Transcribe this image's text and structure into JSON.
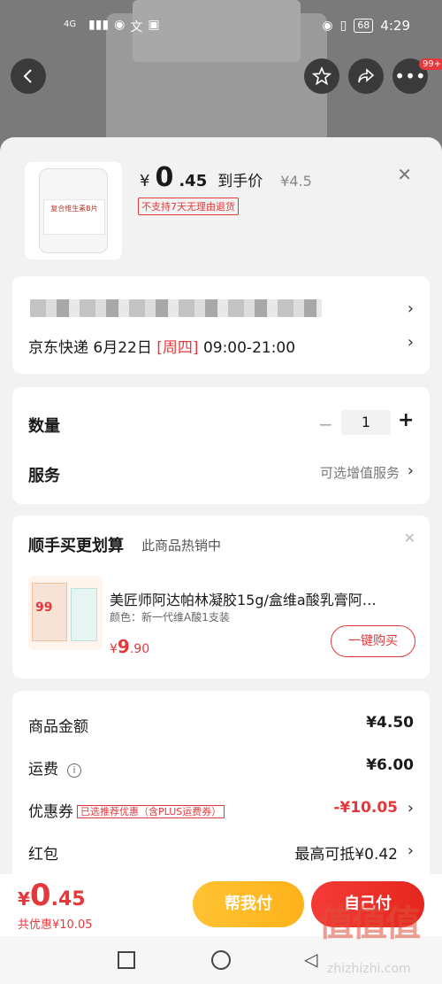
{
  "status_bar": {
    "network": "4G",
    "time": "4:29",
    "battery": "68"
  },
  "nav": {
    "more_badge": "99+"
  },
  "product": {
    "currency": "¥",
    "price_int": "0",
    "price_dec": ".45",
    "price_suffix": "到手价",
    "original_price": "¥4.5",
    "no_return_tag": "不支持7天无理由退货",
    "image_label": "复合维生素B片"
  },
  "address": {
    "delivery_carrier": "京东快递",
    "delivery_date": "6月22日",
    "delivery_day": "[周四]",
    "delivery_window": "09:00-21:00"
  },
  "quantity": {
    "label": "数量",
    "value": "1",
    "minus": "−",
    "plus": "+"
  },
  "service": {
    "label": "服务",
    "hint": "可选增值服务"
  },
  "recommend": {
    "title": "顺手买更划算",
    "subtitle": "此商品热销中",
    "item_name": "美匠师阿达帕林凝胶15g/盒维a酸乳膏阿…",
    "item_color": "颜色：新一代维A酸1支装",
    "item_price_currency": "¥",
    "item_price_int": "9",
    "item_price_dec": ".90",
    "buy_button": "一键购买",
    "img_badge": "99"
  },
  "summary": {
    "goods_label": "商品金额",
    "goods_value": "¥4.50",
    "shipping_label": "运费",
    "shipping_value": "¥6.00",
    "coupon_label": "优惠券",
    "coupon_tag": "已选推荐优惠（含PLUS运费券）",
    "coupon_value": "-¥10.05",
    "redpacket_label": "红包",
    "redpacket_value": "最高可抵¥0.42"
  },
  "bottom": {
    "currency": "¥",
    "price_int": "0",
    "price_dec": ".45",
    "total_saving": "共优惠¥10.05",
    "help_pay": "帮我付",
    "self_pay": "自己付"
  },
  "watermark": {
    "text": "值值值",
    "sub": "zhizhizhi.com"
  },
  "colors": {
    "accent_red": "#e4393c",
    "help_yellow": "#ffb21a"
  }
}
